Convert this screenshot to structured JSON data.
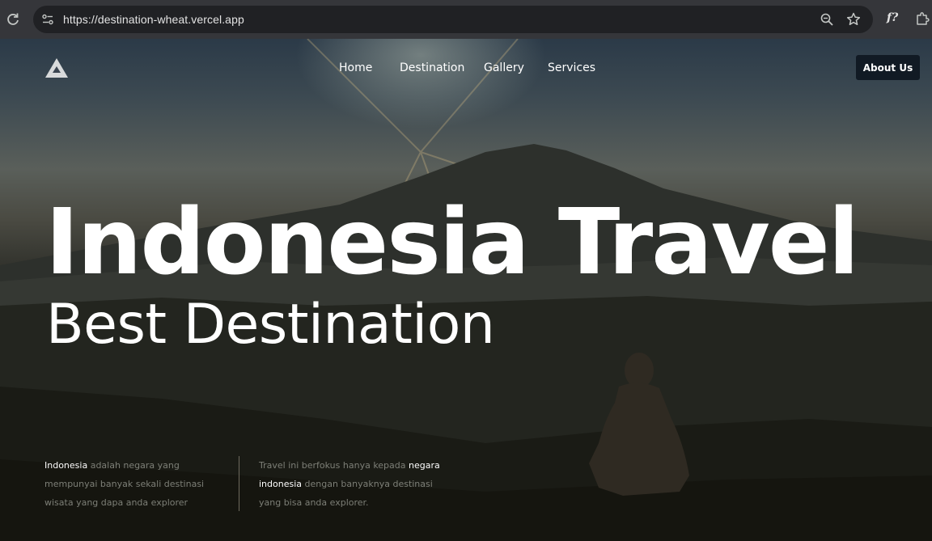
{
  "browser": {
    "url": "https://destination-wheat.vercel.app",
    "icons": [
      "reload-icon",
      "site-info-icon",
      "zoom-icon",
      "bookmark-star-icon",
      "fx-extension-icon",
      "extensions-puzzle-icon"
    ],
    "fx_label": "f?"
  },
  "nav": {
    "links": [
      "Home",
      "Destination",
      "Gallery",
      "Services"
    ],
    "about_label": "About Us"
  },
  "hero": {
    "title": "Indonesia Travel",
    "subtitle": "Best Destination"
  },
  "info": {
    "left": {
      "highlight": "Indonesia",
      "text": " adalah negara yang mempunyai banyak sekali destinasi wisata yang dapa anda explorer"
    },
    "right": {
      "text_before": "Travel ini berfokus hanya kepada ",
      "highlight": "negara indonesia",
      "text_after": " dengan banyaknya destinasi yang bisa anda explorer."
    }
  },
  "colors": {
    "chrome_bg": "#35363a",
    "omnibox_bg": "#202124",
    "button_bg": "#111a24",
    "muted_text": "#7d7f77",
    "text": "#ffffff"
  }
}
